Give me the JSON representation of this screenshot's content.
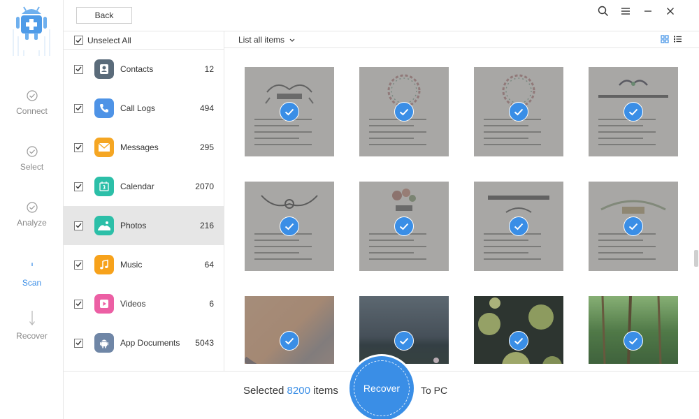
{
  "topbar": {
    "back_label": "Back"
  },
  "steps": [
    {
      "label": "Connect",
      "state": "done"
    },
    {
      "label": "Select",
      "state": "done"
    },
    {
      "label": "Analyze",
      "state": "done"
    },
    {
      "label": "Scan",
      "state": "active"
    },
    {
      "label": "Recover",
      "state": "pending"
    }
  ],
  "categories": {
    "unselect_all_label": "Unselect All",
    "items": [
      {
        "label": "Contacts",
        "count": "12",
        "icon": "contacts-icon",
        "color": "#5a6b7a"
      },
      {
        "label": "Call Logs",
        "count": "494",
        "icon": "phone-icon",
        "color": "#4e93e6"
      },
      {
        "label": "Messages",
        "count": "295",
        "icon": "envelope-icon",
        "color": "#f5a623"
      },
      {
        "label": "Calendar",
        "count": "2070",
        "icon": "calendar-icon",
        "color": "#2cbfa8"
      },
      {
        "label": "Photos",
        "count": "216",
        "icon": "image-icon",
        "color": "#2cbfa8"
      },
      {
        "label": "Music",
        "count": "64",
        "icon": "music-note-icon",
        "color": "#f7a21b"
      },
      {
        "label": "Videos",
        "count": "6",
        "icon": "play-icon",
        "color": "#ec5fa4"
      },
      {
        "label": "App Documents",
        "count": "5043",
        "icon": "android-icon",
        "color": "#6f86a6"
      }
    ]
  },
  "toolbar": {
    "list_filter_label": "List all items"
  },
  "photos": [
    {
      "kind": "document",
      "title": ""
    },
    {
      "kind": "document",
      "title": ""
    },
    {
      "kind": "document",
      "title": ""
    },
    {
      "kind": "document",
      "title": ""
    },
    {
      "kind": "document",
      "title": ""
    },
    {
      "kind": "document",
      "title": ""
    },
    {
      "kind": "document",
      "title": ""
    },
    {
      "kind": "document",
      "title": ""
    },
    {
      "kind": "photo",
      "title": ""
    },
    {
      "kind": "photo",
      "title": ""
    },
    {
      "kind": "photo",
      "title": ""
    },
    {
      "kind": "photo",
      "title": ""
    }
  ],
  "bottom": {
    "selected_prefix": "Selected",
    "selected_count": "8200",
    "selected_suffix": "items",
    "recover_label": "Recover",
    "destination_label": "To PC"
  },
  "colors": {
    "accent": "#3a8ee6"
  }
}
